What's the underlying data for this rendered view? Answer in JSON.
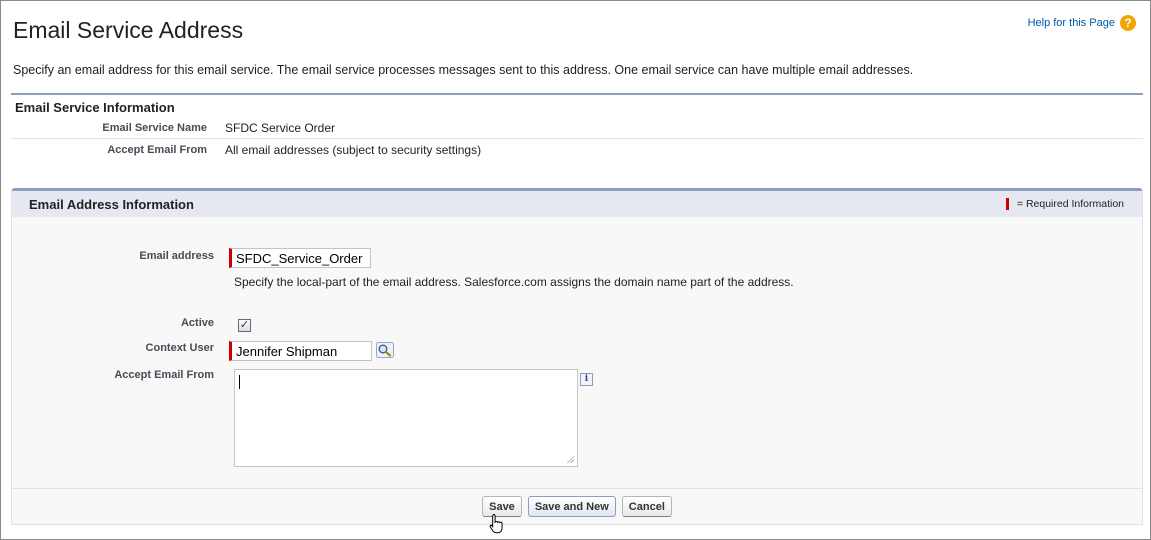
{
  "page": {
    "title": "Email Service Address",
    "help_link": "Help for this Page",
    "help_icon": "?",
    "description": "Specify an email address for this email service. The email service processes messages sent to this address. One email service can have multiple email addresses."
  },
  "service_info": {
    "heading": "Email Service Information",
    "rows": [
      {
        "label": "Email Service Name",
        "value": "SFDC Service Order"
      },
      {
        "label": "Accept Email From",
        "value": "All email addresses (subject to security settings)"
      }
    ]
  },
  "address_info": {
    "heading": "Email Address Information",
    "required_legend": "= Required Information",
    "email_address": {
      "label": "Email address",
      "value": "SFDC_Service_Order",
      "hint": "Specify the local-part of the email address. Salesforce.com assigns the domain name part of the address."
    },
    "active": {
      "label": "Active",
      "checked": true,
      "mark": "✓"
    },
    "context_user": {
      "label": "Context User",
      "value": "Jennifer Shipman"
    },
    "accept_email_from": {
      "label": "Accept Email From",
      "value": "",
      "info_icon": "i"
    }
  },
  "buttons": {
    "save": "Save",
    "save_and_new": "Save and New",
    "cancel": "Cancel"
  },
  "colors": {
    "required": "#cc0000",
    "section_border": "#8e9dbe",
    "link": "#015ba7",
    "help_icon": "#f0a500"
  }
}
